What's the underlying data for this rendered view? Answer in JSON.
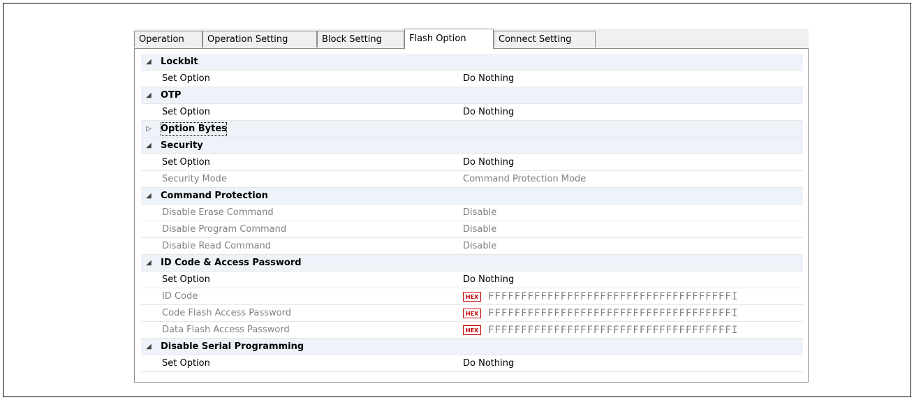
{
  "tabs": [
    {
      "label": "Operation"
    },
    {
      "label": "Operation Setting"
    },
    {
      "label": "Block Setting"
    },
    {
      "label": "Flash Option",
      "active": true
    },
    {
      "label": "Connect Setting"
    }
  ],
  "icons": {
    "expanded": "◢",
    "collapsed": "▷",
    "hex_badge": "HEX"
  },
  "colors": {
    "category_bg": "#eef2f9",
    "disabled_text": "#808080",
    "hex_badge": "#c00000"
  },
  "properties": {
    "lockbit": {
      "title": "Lockbit",
      "set_option": {
        "name": "Set Option",
        "value": "Do Nothing"
      }
    },
    "otp": {
      "title": "OTP",
      "set_option": {
        "name": "Set Option",
        "value": "Do Nothing"
      }
    },
    "option_bytes": {
      "title": "Option Bytes"
    },
    "security": {
      "title": "Security",
      "set_option": {
        "name": "Set Option",
        "value": "Do Nothing"
      },
      "security_mode": {
        "name": "Security Mode",
        "value": "Command Protection Mode"
      }
    },
    "command_protection": {
      "title": "Command Protection",
      "disable_erase": {
        "name": "Disable Erase Command",
        "value": "Disable"
      },
      "disable_program": {
        "name": "Disable Program Command",
        "value": "Disable"
      },
      "disable_read": {
        "name": "Disable Read Command",
        "value": "Disable"
      }
    },
    "id_code": {
      "title": "ID Code & Access Password",
      "set_option": {
        "name": "Set Option",
        "value": "Do Nothing"
      },
      "id_code": {
        "name": "ID Code",
        "value": "FFFFFFFFFFFFFFFFFFFFFFFFFFFFFFFFFFFFFI"
      },
      "code_flash_password": {
        "name": "Code Flash Access Password",
        "value": "FFFFFFFFFFFFFFFFFFFFFFFFFFFFFFFFFFFFFI"
      },
      "data_flash_password": {
        "name": "Data Flash Access Password",
        "value": "FFFFFFFFFFFFFFFFFFFFFFFFFFFFFFFFFFFFFI"
      }
    },
    "disable_serial": {
      "title": "Disable Serial Programming",
      "set_option": {
        "name": "Set Option",
        "value": "Do Nothing"
      }
    }
  }
}
